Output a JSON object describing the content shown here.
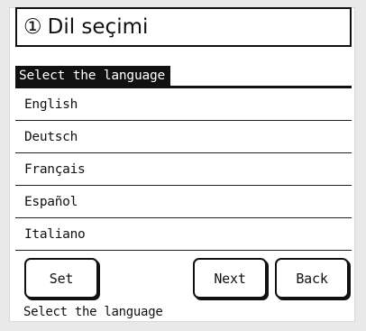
{
  "title": {
    "number": "①",
    "text": "Dil seçimi"
  },
  "list": {
    "header": "Select the language",
    "items": [
      "English",
      "Deutsch",
      "Français",
      "Español",
      "Italiano"
    ]
  },
  "buttons": {
    "set": "Set",
    "next": "Next",
    "back": "Back"
  },
  "status": "Select the language"
}
